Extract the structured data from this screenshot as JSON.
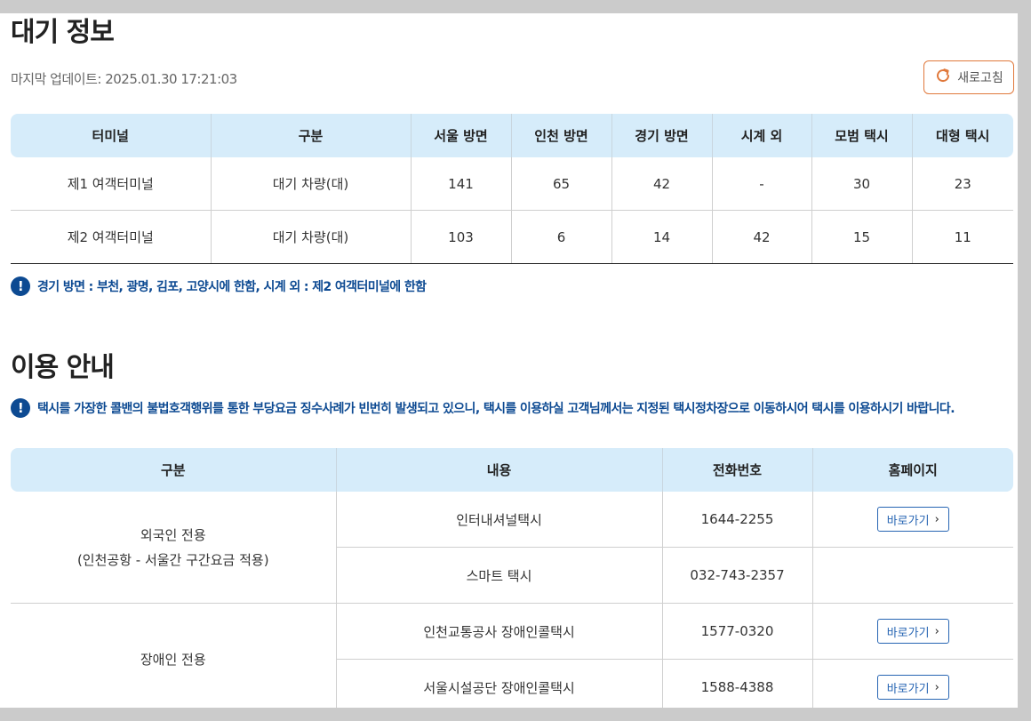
{
  "wait_info": {
    "title": "대기 정보",
    "last_update": "마지막 업데이트: 2025.01.30 17:21:03",
    "refresh_label": "새로고침",
    "headers": [
      "터미널",
      "구분",
      "서울 방면",
      "인천 방면",
      "경기 방면",
      "시계 외",
      "모범 택시",
      "대형 택시"
    ],
    "rows": [
      [
        "제1 여객터미널",
        "대기 차량(대)",
        "141",
        "65",
        "42",
        "-",
        "30",
        "23"
      ],
      [
        "제2 여객터미널",
        "대기 차량(대)",
        "103",
        "6",
        "14",
        "42",
        "15",
        "11"
      ]
    ],
    "notice": "경기 방면 : 부천, 광명, 김포, 고양시에 한함, 시계 외 : 제2 여객터미널에 한함"
  },
  "usage_info": {
    "title": "이용 안내",
    "notice": "택시를 가장한 콜밴의 불법호객행위를 통한 부당요금 징수사례가 빈번히 발생되고 있으니, 택시를 이용하실 고객님께서는 지정된 택시정차장으로 이동하시어 택시를 이용하시기 바랍니다.",
    "headers": [
      "구분",
      "내용",
      "전화번호",
      "홈페이지"
    ],
    "groups": [
      {
        "category_line1": "외국인 전용",
        "category_line2": "(인천공항 - 서울간 구간요금 적용)",
        "items": [
          {
            "name": "인터내셔널택시",
            "phone": "1644-2255",
            "link": "바로가기"
          },
          {
            "name": "스마트 택시",
            "phone": "032-743-2357",
            "link": ""
          }
        ]
      },
      {
        "category_line1": "장애인 전용",
        "items": [
          {
            "name": "인천교통공사 장애인콜택시",
            "phone": "1577-0320",
            "link": "바로가기"
          },
          {
            "name": "서울시설공단 장애인콜택시",
            "phone": "1588-4388",
            "link": "바로가기"
          }
        ]
      }
    ]
  },
  "colors": {
    "accent_blue": "#0d4a92",
    "header_bg": "#d6ecfa",
    "refresh_border": "#e0793c"
  }
}
